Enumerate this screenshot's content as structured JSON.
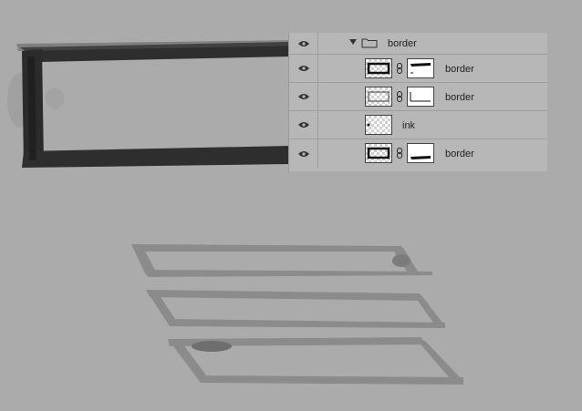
{
  "layers_panel": {
    "group": {
      "name": "border",
      "expanded": true,
      "visible": true
    },
    "layers": [
      {
        "name": "border",
        "visible": true,
        "has_mask": true,
        "linked": true,
        "selected": false
      },
      {
        "name": "border",
        "visible": true,
        "has_mask": true,
        "linked": true,
        "selected": false
      },
      {
        "name": "ink",
        "visible": true,
        "has_mask": false,
        "linked": false,
        "selected": false
      },
      {
        "name": "border",
        "visible": true,
        "has_mask": true,
        "linked": true,
        "selected": false
      }
    ]
  },
  "colors": {
    "canvas_bg": "#ababab",
    "panel_bg": "#b7b7b7",
    "ink_dark": "#2f2f2f",
    "ink_mid": "#8a8a8a"
  },
  "icons": {
    "visibility": "eye-icon",
    "disclosure": "triangle-down-icon",
    "group": "folder-icon",
    "link": "chain-link-icon"
  }
}
